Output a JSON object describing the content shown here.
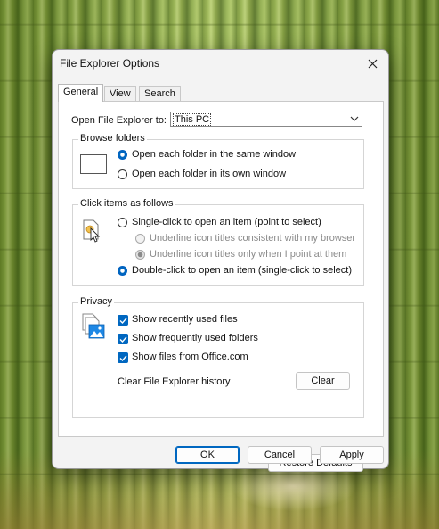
{
  "window": {
    "title": "File Explorer Options"
  },
  "tabs": [
    {
      "label": "General",
      "active": true
    },
    {
      "label": "View",
      "active": false
    },
    {
      "label": "Search",
      "active": false
    }
  ],
  "general": {
    "open_to_label": "Open File Explorer to:",
    "open_to_value": "This PC",
    "browse_folders": {
      "title": "Browse folders",
      "option_same_window": "Open each folder in the same window",
      "option_own_window": "Open each folder in its own window",
      "selected": "same_window"
    },
    "click_items": {
      "title": "Click items as follows",
      "option_single_click": "Single-click to open an item (point to select)",
      "sub_underline_browser": "Underline icon titles consistent with my browser",
      "sub_underline_point": "Underline icon titles only when I point at them",
      "option_double_click": "Double-click to open an item (single-click to select)",
      "selected": "double_click"
    },
    "privacy": {
      "title": "Privacy",
      "show_recent_files": "Show recently used files",
      "show_frequent_folders": "Show frequently used folders",
      "show_office_files": "Show files from Office.com",
      "recent_checked": true,
      "frequent_checked": true,
      "office_checked": true,
      "clear_history_label": "Clear File Explorer history",
      "clear_button": "Clear"
    },
    "restore_defaults": "Restore Defaults"
  },
  "footer": {
    "ok": "OK",
    "cancel": "Cancel",
    "apply": "Apply"
  },
  "colors": {
    "accent": "#0067c0",
    "dialog_bg": "#f3f3f3",
    "panel_bg": "#ffffff"
  },
  "icons": {
    "close": "close-icon",
    "dropdown": "chevron-down-icon",
    "browse": "window-outline-icon",
    "click": "pointer-file-icon",
    "privacy": "documents-image-icon",
    "check": "checkmark-icon"
  }
}
